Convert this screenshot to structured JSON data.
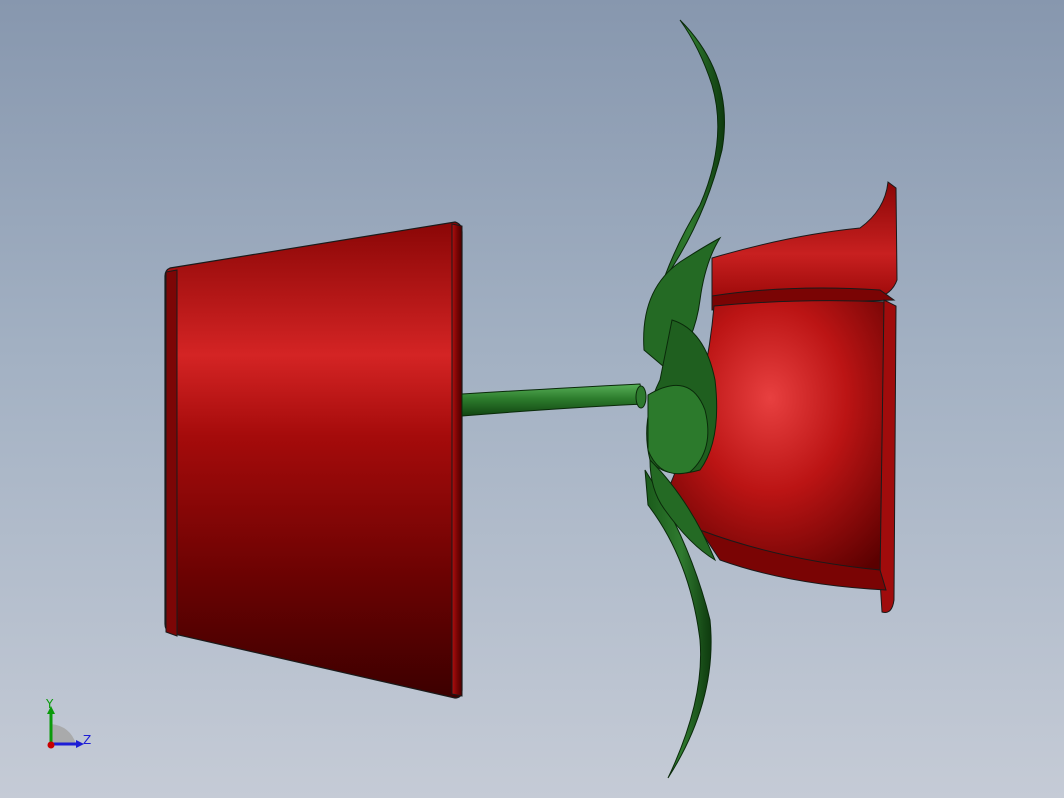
{
  "viewport": {
    "background_top": "#8797ae",
    "background_bottom": "#c5cbd6"
  },
  "model": {
    "parts": [
      "pot",
      "stem",
      "sepals",
      "leaves",
      "rose-bloom"
    ],
    "colors": {
      "pot": "#a80a0a",
      "bloom": "#c01818",
      "foliage": "#246a24",
      "edge": "#1a1a1a"
    }
  },
  "triad": {
    "y_label": "Y",
    "z_label": "Z",
    "colors": {
      "y": "#0a9a0a",
      "z": "#1d1dd6",
      "x": "#c80000"
    }
  }
}
